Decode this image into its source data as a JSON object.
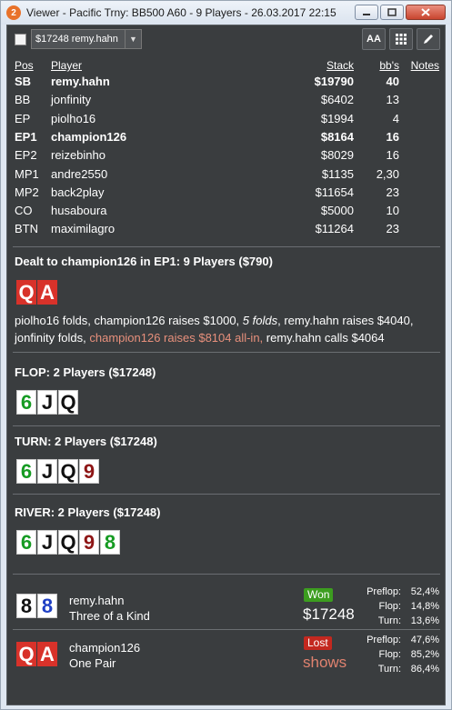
{
  "window": {
    "app_icon": "2",
    "title": "Viewer - Pacific Trny: BB500 A60 - 9 Players - 26.03.2017 22:15"
  },
  "toolbar": {
    "player_select": "$17248 remy.hahn",
    "font_button": "AA"
  },
  "table": {
    "headers": {
      "pos": "Pos",
      "player": "Player",
      "stack": "Stack",
      "bbs": "bb's",
      "notes": "Notes"
    },
    "rows": [
      {
        "pos": "SB",
        "player": "remy.hahn",
        "stack": "$19790",
        "bbs": "40",
        "bold": true
      },
      {
        "pos": "BB",
        "player": "jonfinity",
        "stack": "$6402",
        "bbs": "13",
        "bold": false
      },
      {
        "pos": "EP",
        "player": "piolho16",
        "stack": "$1994",
        "bbs": "4",
        "bold": false
      },
      {
        "pos": "EP1",
        "player": "champion126",
        "stack": "$8164",
        "bbs": "16",
        "bold": true
      },
      {
        "pos": "EP2",
        "player": "reizebinho",
        "stack": "$8029",
        "bbs": "16",
        "bold": false
      },
      {
        "pos": "MP1",
        "player": "andre2550",
        "stack": "$1135",
        "bbs": "2,30",
        "bold": false
      },
      {
        "pos": "MP2",
        "player": "back2play",
        "stack": "$11654",
        "bbs": "23",
        "bold": false
      },
      {
        "pos": "CO",
        "player": "husaboura",
        "stack": "$5000",
        "bbs": "10",
        "bold": false
      },
      {
        "pos": "BTN",
        "player": "maximilagro",
        "stack": "$11264",
        "bbs": "23",
        "bold": false
      }
    ]
  },
  "preflop": {
    "title": "Dealt to champion126 in EP1: 9 Players ($790)",
    "hole_cards": [
      "Q",
      "A"
    ],
    "action_1": "piolho16 folds, champion126 raises $1000, ",
    "action_2": "5 folds",
    "action_3": ", remy.hahn raises $4040, jonfinity folds, ",
    "action_4": "champion126 raises $8104 all-in,",
    "action_5": " remy.hahn calls $4064"
  },
  "flop": {
    "title": "FLOP: 2 Players ($17248)",
    "cards": [
      "6",
      "J",
      "Q"
    ]
  },
  "turn": {
    "title": "TURN: 2 Players ($17248)",
    "cards": [
      "6",
      "J",
      "Q",
      "9"
    ]
  },
  "river": {
    "title": "RIVER: 2 Players ($17248)",
    "cards": [
      "6",
      "J",
      "Q",
      "9",
      "8"
    ]
  },
  "results": [
    {
      "cards": [
        "8",
        "8"
      ],
      "player": "remy.hahn",
      "hand": "Three of a Kind",
      "badge": "Won",
      "outcome": "$17248",
      "equity": [
        {
          "label": "Preflop:",
          "value": "52,4%"
        },
        {
          "label": "Flop:",
          "value": "14,8%"
        },
        {
          "label": "Turn:",
          "value": "13,6%"
        }
      ]
    },
    {
      "cards": [
        "Q",
        "A"
      ],
      "player": "champion126",
      "hand": "One Pair",
      "badge": "Lost",
      "outcome": "shows",
      "equity": [
        {
          "label": "Preflop:",
          "value": "47,6%"
        },
        {
          "label": "Flop:",
          "value": "85,2%"
        },
        {
          "label": "Turn:",
          "value": "86,4%"
        }
      ]
    }
  ],
  "colors": {
    "background": "#3a3d3f",
    "won": "#3c9d1f",
    "lost": "#c3281f",
    "all_in_text": "#e8907c"
  },
  "icons": [
    "app-logo-icon",
    "minimize-icon",
    "maximize-icon",
    "close-icon",
    "dropdown-arrow-icon",
    "grid-icon",
    "pencil-icon"
  ]
}
